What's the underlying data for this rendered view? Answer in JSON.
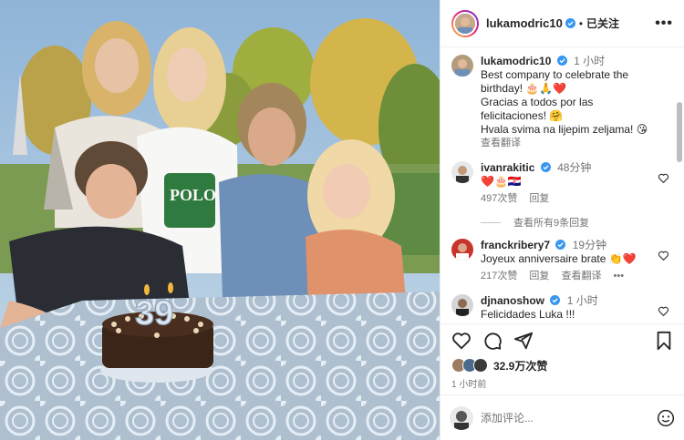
{
  "post": {
    "username": "lukamodric10",
    "follow_label": "已关注",
    "more_label": "•••",
    "photo_alt": "photo",
    "candle_number": "39"
  },
  "caption": {
    "username": "lukamodric10",
    "time": "1 小时",
    "line1": "Best company to celebrate the birthday! 🎂🙏❤️",
    "line2": "Gracias a todos por las felicitaciones! 🤗",
    "line3": "Hvala svima na lijepim zeljama! 😘",
    "translate": "查看翻译"
  },
  "comments": [
    {
      "username": "ivanrakitic",
      "time": "48分钟",
      "text": "❤️🎂🇭🇷",
      "likes": "497次赞",
      "reply": "回复",
      "view_replies": "查看所有9条回复"
    },
    {
      "username": "franckribery7",
      "time": "19分钟",
      "text": "Joyeux anniversaire brate 👏❤️",
      "likes": "217次赞",
      "reply": "回复",
      "translate": "查看翻译",
      "more": "•••"
    },
    {
      "username": "djnanoshow",
      "time": "1 小时",
      "text": "Felicidades Luka !!!"
    }
  ],
  "actions": {
    "like_count": "32.9万次赞",
    "posted_ago": "1 小时前"
  },
  "comment_box": {
    "placeholder": "添加评论..."
  },
  "colors": {
    "verified": "#3897f0",
    "heart": "#ed4956",
    "muted": "#737373"
  }
}
